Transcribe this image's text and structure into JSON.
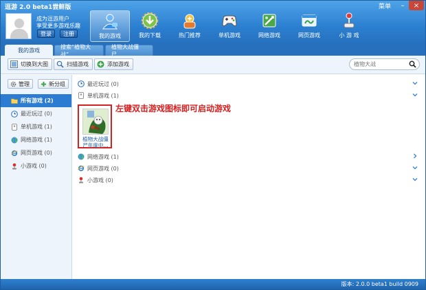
{
  "window": {
    "title": "逗游 2.0 beta1尝鲜版",
    "menu_label": "菜单",
    "minimize": "–",
    "close": "×"
  },
  "user": {
    "line1": "成为逗游用户",
    "line2": "享受更多游戏乐趣",
    "login": "登录",
    "register": "注册"
  },
  "nav": [
    {
      "label": "我的游戏",
      "icon": "my-games-icon"
    },
    {
      "label": "我的下载",
      "icon": "download-icon"
    },
    {
      "label": "热门推荐",
      "icon": "recommend-icon"
    },
    {
      "label": "单机游戏",
      "icon": "gamepad-icon"
    },
    {
      "label": "网络游戏",
      "icon": "online-game-icon"
    },
    {
      "label": "网页游戏",
      "icon": "web-game-icon"
    },
    {
      "label": "小 游 戏",
      "icon": "joystick-icon"
    }
  ],
  "tabs": [
    {
      "label": "我的游戏"
    },
    {
      "label": "搜索“植物大战”"
    },
    {
      "label": "植物大战僵尸..."
    }
  ],
  "toolbar": {
    "switch_view": "切换到大图",
    "scan_games": "扫描游戏",
    "add_game": "添加游戏",
    "search_placeholder": "植物大战"
  },
  "sidebar": {
    "manage": "管理",
    "new_group": "新分组",
    "items": [
      {
        "label": "所有游戏 (2)",
        "icon": "folder-icon"
      },
      {
        "label": "最近玩过 (0)",
        "icon": "clock-icon"
      },
      {
        "label": "单机游戏 (1)",
        "icon": "gamepad-icon"
      },
      {
        "label": "网络游戏 (1)",
        "icon": "globe-icon"
      },
      {
        "label": "网页游戏 (0)",
        "icon": "ie-icon"
      },
      {
        "label": "小游戏 (0)",
        "icon": "joystick-icon"
      }
    ]
  },
  "main": {
    "groups": [
      {
        "label": "最近玩过 (0)",
        "icon": "clock-icon"
      },
      {
        "label": "单机游戏 (1)",
        "icon": "gamepad-icon"
      },
      {
        "label": "网络游戏 (1)",
        "icon": "globe-icon"
      },
      {
        "label": "网页游戏 (0)",
        "icon": "ie-icon"
      },
      {
        "label": "小游戏 (0)",
        "icon": "joystick-icon"
      }
    ],
    "game_tile": {
      "name": "植物大战僵尸年度中..."
    },
    "hint": "左键双击游戏图标即可启动游戏"
  },
  "status": {
    "version": "版本: 2.0.0 beta1 build 0909"
  },
  "colors": {
    "header": "#2b7fd0",
    "sidebar_active": "#2c7cd1",
    "hint": "#d81e1e",
    "tile_border": "#d32222"
  }
}
